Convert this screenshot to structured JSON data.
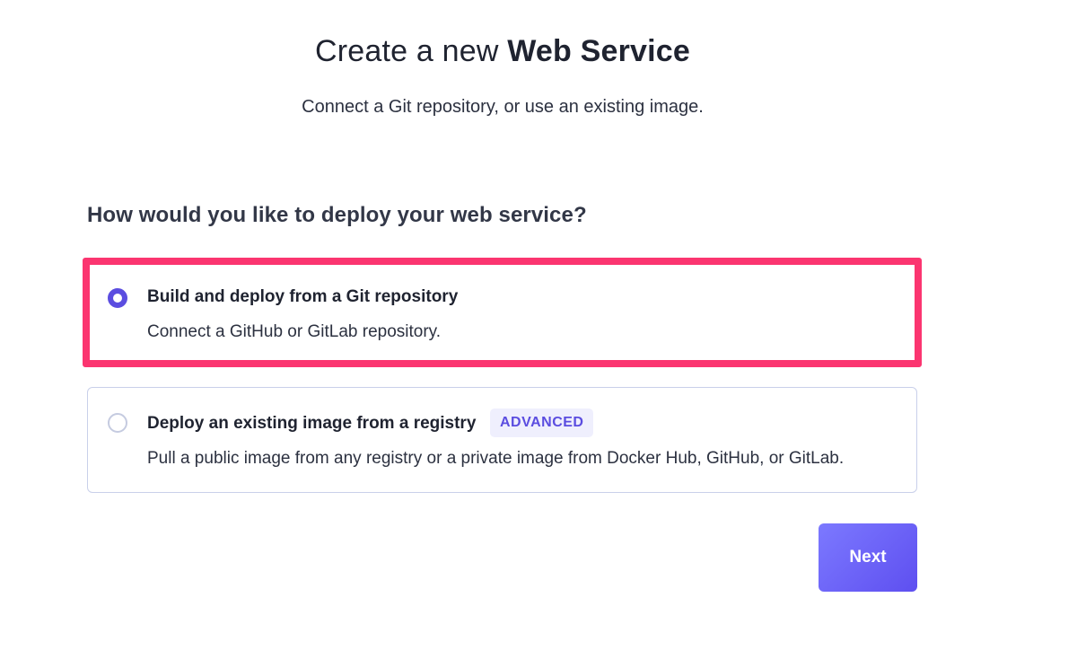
{
  "header": {
    "title_prefix": "Create a new",
    "title_strong": "Web Service",
    "subtitle": "Connect a Git repository, or use an existing image."
  },
  "deploy": {
    "question": "How would you like to deploy your web service?",
    "options": [
      {
        "title": "Build and deploy from a Git repository",
        "description": "Connect a GitHub or GitLab repository.",
        "selected": true
      },
      {
        "title": "Deploy an existing image from a registry",
        "badge": "ADVANCED",
        "description": "Pull a public image from any registry or a private image from Docker Hub, GitHub, or GitLab.",
        "selected": false
      }
    ]
  },
  "actions": {
    "next_label": "Next"
  },
  "colors": {
    "accent": "#5b4de0",
    "highlight_border": "#fb3570",
    "badge_bg": "#efeffd"
  }
}
